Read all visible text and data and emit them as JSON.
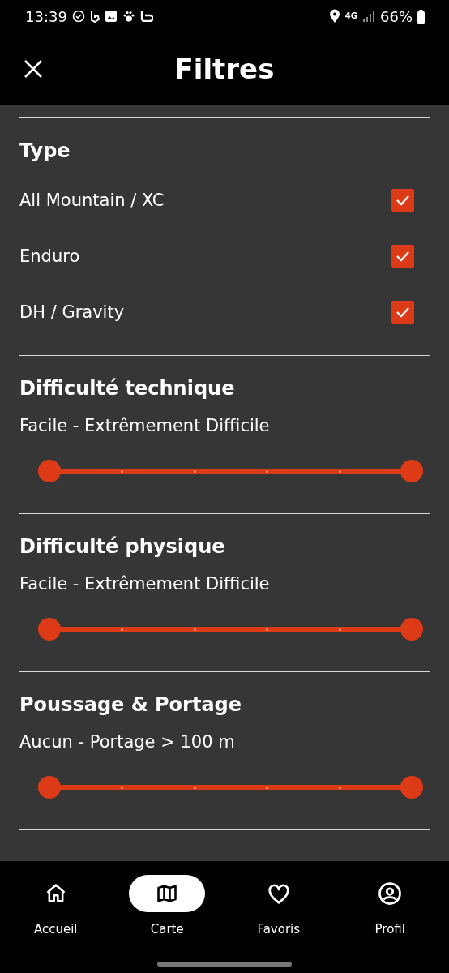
{
  "status_bar": {
    "time": "13:39",
    "network": "4G",
    "battery": "66%"
  },
  "header": {
    "title": "Filtres"
  },
  "type_section": {
    "title": "Type",
    "options": [
      {
        "label": "All Mountain / XC",
        "checked": true
      },
      {
        "label": "Enduro",
        "checked": true
      },
      {
        "label": "DH / Gravity",
        "checked": true
      }
    ]
  },
  "range_sections": [
    {
      "title": "Difficulté technique",
      "summary": "Facile - Extrêmement Difficile"
    },
    {
      "title": "Difficulté physique",
      "summary": "Facile - Extrêmement Difficile"
    },
    {
      "title": "Poussage & Portage",
      "summary": "Aucun - Portage > 100 m"
    }
  ],
  "bottom_nav": [
    {
      "label": "Accueil",
      "selected": false
    },
    {
      "label": "Carte",
      "selected": true
    },
    {
      "label": "Favoris",
      "selected": false
    },
    {
      "label": "Profil",
      "selected": false
    }
  ]
}
